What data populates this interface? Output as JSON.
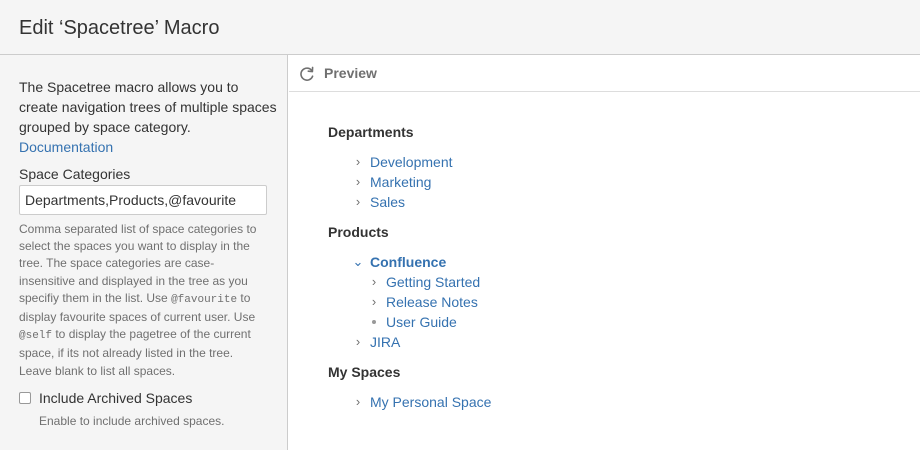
{
  "dialog": {
    "title": "Edit ‘Spacetree’ Macro"
  },
  "left": {
    "description": "The Spacetree macro allows you to create navigation trees of multiple spaces grouped by space category.",
    "doc_link": "Documentation",
    "space_categories_label": "Space Categories",
    "space_categories_value": "Departments,Products,@favourite",
    "help": {
      "p1": "Comma separated list of space categories to select the spaces you want to display in the tree. The space categories are case-insensitive and displayed in the tree as you specifiy them in the list. Use ",
      "code1": "@favourite",
      "p2": " to display favourite spaces of current user. Use ",
      "code2": "@self",
      "p3": " to display the pagetree of the current space, if its not already listed in the tree. Leave blank to list all spaces."
    },
    "archived_label": "Include Archived Spaces",
    "archived_checked": false,
    "archived_help": "Enable to include archived spaces."
  },
  "preview": {
    "title": "Preview",
    "refresh_icon": "refresh-icon",
    "groups": [
      {
        "heading": "Departments",
        "items": [
          "Development",
          "Marketing",
          "Sales"
        ]
      },
      {
        "heading": "Products",
        "items": [
          "Confluence",
          "Getting Started",
          "Release Notes",
          "User Guide",
          "JIRA"
        ]
      },
      {
        "heading": "My Spaces",
        "items": [
          "My Personal Space"
        ]
      }
    ]
  },
  "colors": {
    "link": "#3572b0",
    "panel_bg": "#f5f5f5",
    "border": "#cccccc"
  }
}
